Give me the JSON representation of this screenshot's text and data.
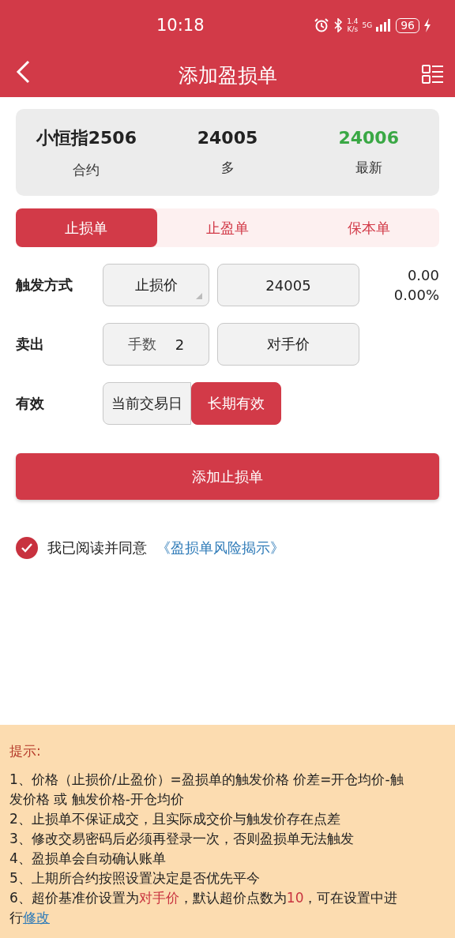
{
  "status_bar": {
    "time": "10:18",
    "speed_value": "1.4",
    "speed_unit": "K/s",
    "network": "5G",
    "battery": "96"
  },
  "header": {
    "title": "添加盈损单"
  },
  "quote": [
    {
      "value": "小恒指2506",
      "label": "合约",
      "color": "#222222"
    },
    {
      "value": "24005",
      "label": "多",
      "color": "#222222"
    },
    {
      "value": "24006",
      "label": "最新",
      "color": "#3aa845"
    }
  ],
  "tabs": [
    {
      "label": "止损单",
      "selected": true
    },
    {
      "label": "止盈单",
      "selected": false
    },
    {
      "label": "保本单",
      "selected": false
    }
  ],
  "trigger": {
    "label": "触发方式",
    "mode": "止损价",
    "price": "24005",
    "diff": "0.00",
    "diff_pct": "0.00%"
  },
  "sell": {
    "label": "卖出",
    "qty_label": "手数",
    "qty": "2",
    "price_type": "对手价"
  },
  "validity": {
    "label": "有效",
    "options": [
      {
        "label": "当前交易日",
        "selected": false
      },
      {
        "label": "长期有效",
        "selected": true
      }
    ]
  },
  "submit": "添加止损单",
  "agreement": {
    "checked": true,
    "text": "我已阅读并同意",
    "link": "《盈损单风险揭示》"
  },
  "tips": {
    "title": "提示:",
    "items": [
      [
        {
          "kind": "plain",
          "text": "1、价格（止损价/止盈价）=盈损单的触发价格 价差=开仓均价-触发价格 或 触发价格-开仓均价"
        }
      ],
      [
        {
          "kind": "plain",
          "text": "2、止损单不保证成交，且实际成交价与触发价存在点差"
        }
      ],
      [
        {
          "kind": "plain",
          "text": "3、修改交易密码后必须再登录一次，否则盈损单无法触发"
        }
      ],
      [
        {
          "kind": "plain",
          "text": "4、盈损单会自动确认账单"
        }
      ],
      [
        {
          "kind": "plain",
          "text": "5、上期所合约按照设置决定是否优先平今"
        }
      ],
      [
        {
          "kind": "plain",
          "text": "6、超价基准价设置为"
        },
        {
          "kind": "highlight",
          "text": "对手价"
        },
        {
          "kind": "plain",
          "text": "，默认超价点数为"
        },
        {
          "kind": "highlight",
          "text": "10"
        },
        {
          "kind": "plain",
          "text": "，可在设置中进行"
        },
        {
          "kind": "link",
          "text": "修改"
        }
      ]
    ]
  }
}
